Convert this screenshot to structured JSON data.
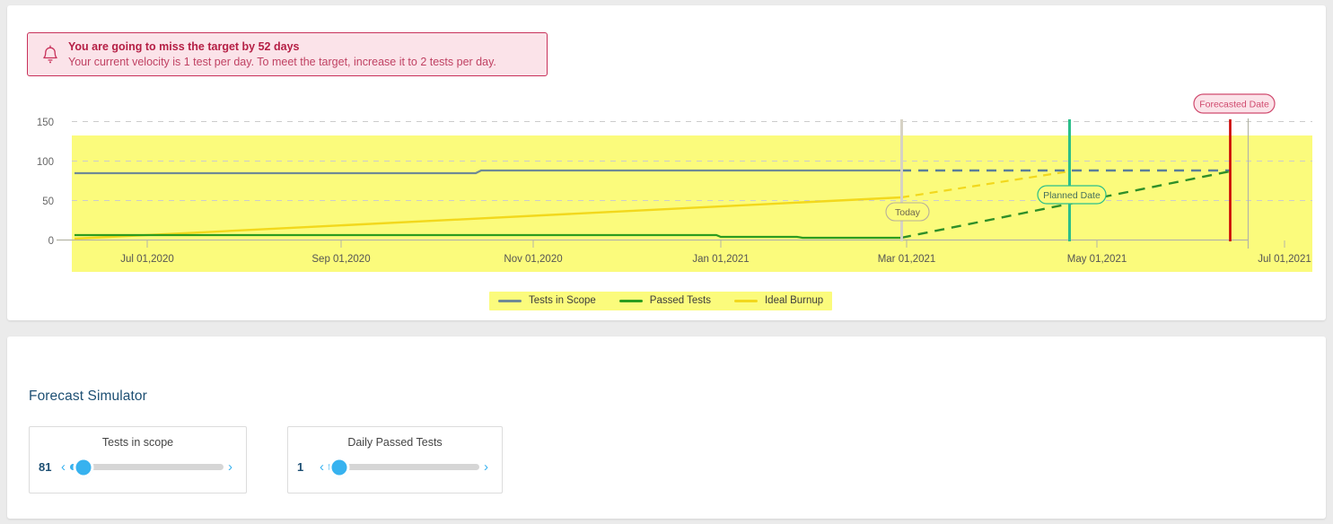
{
  "alert": {
    "icon": "bell-icon",
    "title": "You are going to miss the target by 52 days",
    "subtitle": "Your current velocity is 1 test per day. To meet the target, increase it to 2 tests per day."
  },
  "chart_data": {
    "type": "line",
    "title": "",
    "xlabel": "",
    "ylabel": "",
    "ylim": [
      0,
      150
    ],
    "yticks": [
      "0",
      "50",
      "100",
      "150"
    ],
    "ytick_values": [
      0,
      50,
      100,
      150
    ],
    "xticks": [
      "Jul 01,2020",
      "Sep 01,2020",
      "Nov 01,2020",
      "Jan 01,2021",
      "Mar 01,2021",
      "May 01,2021",
      "Jul 01,2021"
    ],
    "grid": true,
    "legend_position": "bottom",
    "plot_band_color": "#fbfb7c",
    "series": [
      {
        "name": "Tests in Scope",
        "color": "#6f8a95",
        "actual": [
          {
            "x": "Jun 01,2020",
            "y": 78
          },
          {
            "x": "Oct 10,2020",
            "y": 78
          },
          {
            "x": "Oct 12,2020",
            "y": 81
          },
          {
            "x": "Feb 22,2021",
            "y": 81
          }
        ],
        "forecast": [
          {
            "x": "Feb 22,2021",
            "y": 81
          },
          {
            "x": "Jun 10,2021",
            "y": 81
          }
        ],
        "forecast_style": "dashed"
      },
      {
        "name": "Passed Tests",
        "color": "#2c9c1f",
        "actual": [
          {
            "x": "Jun 01,2020",
            "y": 5
          },
          {
            "x": "Dec 20,2020",
            "y": 5
          },
          {
            "x": "Feb 22,2021",
            "y": 3
          }
        ],
        "forecast": [
          {
            "x": "Feb 22,2021",
            "y": 3
          },
          {
            "x": "Jun 10,2021",
            "y": 81
          }
        ],
        "forecast_style": "dashed"
      },
      {
        "name": "Ideal Burnup",
        "color": "#f2d81c",
        "actual": [
          {
            "x": "Jun 08,2020",
            "y": 0
          },
          {
            "x": "Feb 22,2021",
            "y": 58
          }
        ],
        "forecast": [
          {
            "x": "Feb 22,2021",
            "y": 58
          },
          {
            "x": "Apr 30,2021",
            "y": 81
          }
        ],
        "forecast_style": "dashed"
      }
    ],
    "markers": [
      {
        "label": "Today",
        "x": "Mar 01,2021",
        "line_color": "#d6d2c4",
        "text_color": "#7a7256",
        "badge_border": "#b8b09a",
        "badge_fill": "#fbfb7c"
      },
      {
        "label": "Planned Date",
        "x": "Apr 30,2021",
        "line_color": "#2bbf8a",
        "text_color": "#3a6b52",
        "badge_border": "#2bbf8a",
        "badge_fill": "#fbfb7c"
      },
      {
        "label": "Forecasted Date",
        "x": "Jun 10,2021",
        "line_color": "#cc0000",
        "text_color": "#d04a6e",
        "badge_border": "#d04a6e",
        "badge_fill": "#fbe3e9"
      }
    ]
  },
  "legend": [
    {
      "label": "Tests in Scope",
      "color": "#6f8a95"
    },
    {
      "label": "Passed Tests",
      "color": "#2c9c1f"
    },
    {
      "label": "Ideal Burnup",
      "color": "#f2d81c"
    }
  ],
  "simulator": {
    "title": "Forecast Simulator",
    "sliders": [
      {
        "label": "Tests in scope",
        "value": "81",
        "fill_percent": 6,
        "thumb_percent": 9,
        "prev_icon": "chevron-left-icon",
        "next_icon": "chevron-right-icon"
      },
      {
        "label": "Daily Passed Tests",
        "value": "1",
        "fill_percent": 2,
        "thumb_percent": 7,
        "prev_icon": "chevron-left-icon",
        "next_icon": "chevron-right-icon"
      }
    ]
  },
  "colors": {
    "accent": "#37b2ef",
    "alert_border": "#c8315a",
    "alert_bg": "#fbe3e9",
    "heading": "#1d4f73",
    "page_bg": "#ebebeb"
  }
}
